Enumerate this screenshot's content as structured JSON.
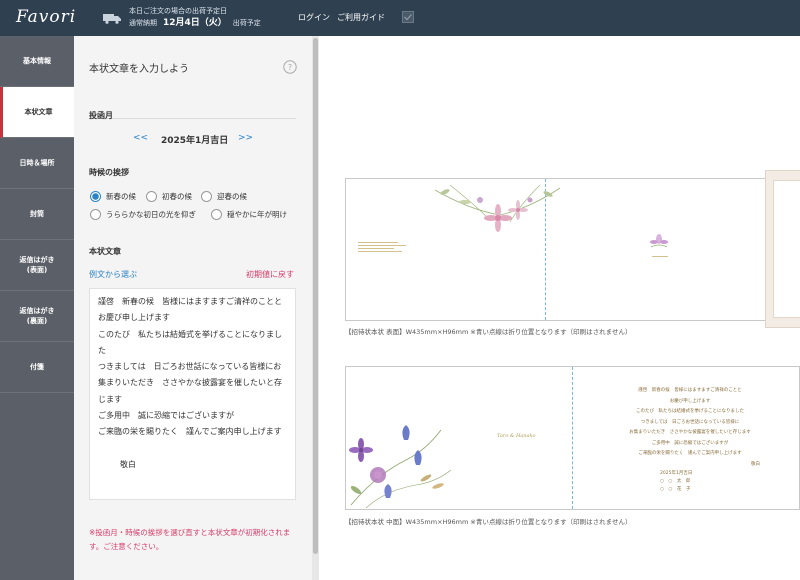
{
  "header": {
    "logo": "Favori",
    "ship_line1": "本日ご注文の場合の出荷予定日",
    "ship_label": "通常納期",
    "ship_date": "12月4日（火）",
    "ship_suffix": "出荷予定",
    "login": "ログイン",
    "guide": "ご利用ガイド",
    "icons": {
      "truck": "truck-icon",
      "check": "checkbox-icon"
    }
  },
  "sidebar": {
    "items": [
      {
        "label": "基本情報",
        "active": false
      },
      {
        "label": "本状文章",
        "active": true
      },
      {
        "label": "日時＆場所",
        "active": false
      },
      {
        "label": "封筒",
        "active": false
      },
      {
        "label": "返信はがき\n(表面)",
        "active": false
      },
      {
        "label": "返信はがき\n(裏面)",
        "active": false
      },
      {
        "label": "付箋",
        "active": false
      }
    ]
  },
  "form": {
    "title": "本状文章を入力しよう",
    "help_icon": "question-circle-icon",
    "month_label": "投函月",
    "month_prev": "<<",
    "month_value": "2025年1月吉日",
    "month_next": ">>",
    "greeting_label": "時候の挨拶",
    "greetings": [
      {
        "label": "新春の候",
        "selected": true
      },
      {
        "label": "初春の候",
        "selected": false
      },
      {
        "label": "迎春の候",
        "selected": false
      },
      {
        "label": "うららかな初日の光を仰ぎ",
        "selected": false
      },
      {
        "label": "穏やかに年が明け",
        "selected": false
      }
    ],
    "body_label": "本状文章",
    "example_link": "例文から選ぶ",
    "reset_link": "初期値に戻す",
    "body_text": "謹啓　新春の候　皆様にはますますご清祥のこととお慶び申し上げます\nこのたび　私たちは結婚式を挙げることになりました\nつきましては　日ごろお世話になっている皆様にお集まりいただき　ささやかな披露宴を催したいと存じます\nご多用中　誠に恐縮ではございますが\nご来臨の栄を賜りたく　謹んでご案内申し上げます",
    "closing": "敬白",
    "warning": "※投函月・時候の挨拶を選び直すと本状文章が初期化されます。ご注意ください。"
  },
  "preview": {
    "front_caption": "【招待状本状 表面】W435mm×H96mm ※青い点線は折り位置となります（印刷はされません）",
    "inner_caption": "【招待状本状 中面】W435mm×H96mm ※青い点線は折り位置となります（印刷はされません）",
    "couple_names": "Taro & Hanako",
    "letter_lines": [
      "謹啓　新春の候　皆様にはますますご清祥のことと",
      "お慶び申し上げます",
      "このたび　私たちは結婚式を挙げることになりました",
      "つきましては　日ごろお世話になっている皆様に",
      "お集まりいただき　ささやかな披露宴を催したいと存じます",
      "ご多用中　誠に恐縮ではございますが",
      "ご来臨の栄を賜りたく　謹んでご案内申し上げます"
    ],
    "letter_closing": "敬白",
    "letter_date": "2025年1月吉日",
    "sign1": "○　○　太　郎",
    "sign2": "○　○　花　子"
  },
  "colors": {
    "header_bg": "#2f4050",
    "sidebar_bg": "#5b6068",
    "active_marker": "#c8323c",
    "link_blue": "#2b83c6",
    "warn_pink": "#d63b6a",
    "fold_line": "#7fb4d8"
  }
}
